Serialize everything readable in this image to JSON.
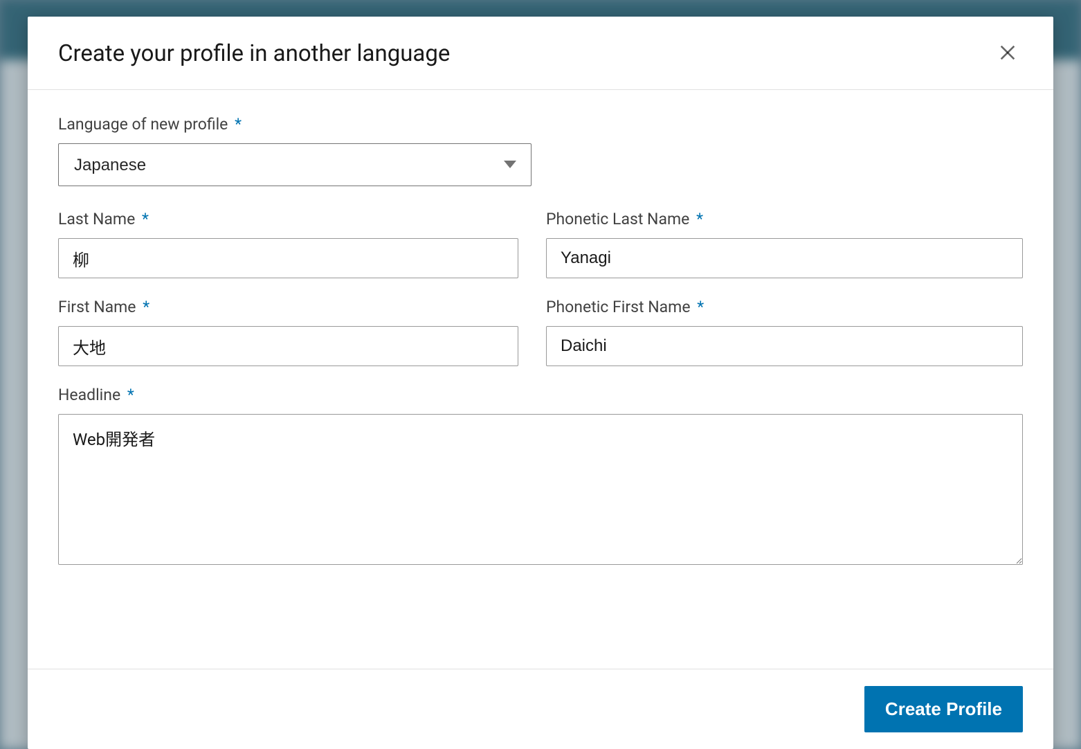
{
  "modal": {
    "title": "Create your profile in another language",
    "form": {
      "language": {
        "label": "Language of new profile",
        "value": "Japanese"
      },
      "lastName": {
        "label": "Last Name",
        "value": "柳"
      },
      "phoneticLastName": {
        "label": "Phonetic Last Name",
        "value": "Yanagi"
      },
      "firstName": {
        "label": "First Name",
        "value": "大地"
      },
      "phoneticFirstName": {
        "label": "Phonetic First Name",
        "value": "Daichi"
      },
      "headline": {
        "label": "Headline",
        "value": "Web開発者"
      },
      "requiredMark": "*"
    },
    "footer": {
      "submitLabel": "Create Profile"
    }
  }
}
